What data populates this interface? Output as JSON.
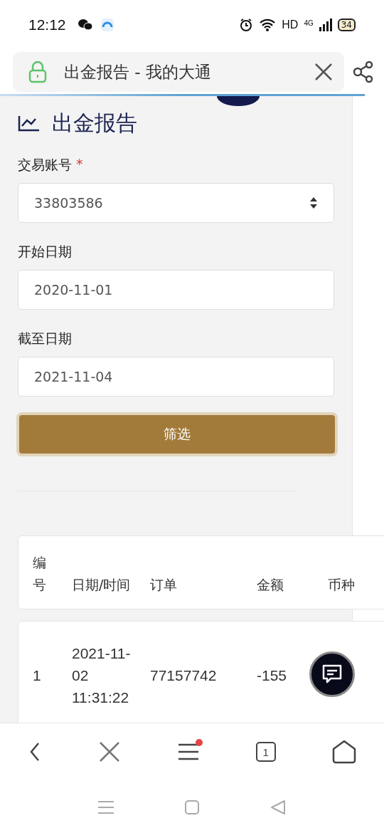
{
  "status_bar": {
    "time": "12:12",
    "hd": "HD",
    "network": "4G",
    "battery": "34"
  },
  "address_bar": {
    "title": "出金报告 - 我的大通"
  },
  "page": {
    "heading": "出金报告"
  },
  "form": {
    "fields": [
      {
        "kind": "select",
        "label": "交易账号",
        "required_mark": "*",
        "value": "33803586"
      },
      {
        "kind": "text",
        "label": "开始日期",
        "value": "2020-11-01"
      },
      {
        "kind": "text",
        "label": "截至日期",
        "value": "2021-11-04"
      }
    ],
    "button": "筛选"
  },
  "table": {
    "columns": [
      "编号",
      "日期/时间",
      "订单",
      "金额",
      "币种"
    ],
    "rows": [
      {
        "cells": [
          "1",
          "2021-11-02 11:31:22",
          "77157742",
          "-155"
        ]
      }
    ]
  },
  "bottom_nav": {
    "tab_count": "1",
    "menu_badge": true
  }
}
